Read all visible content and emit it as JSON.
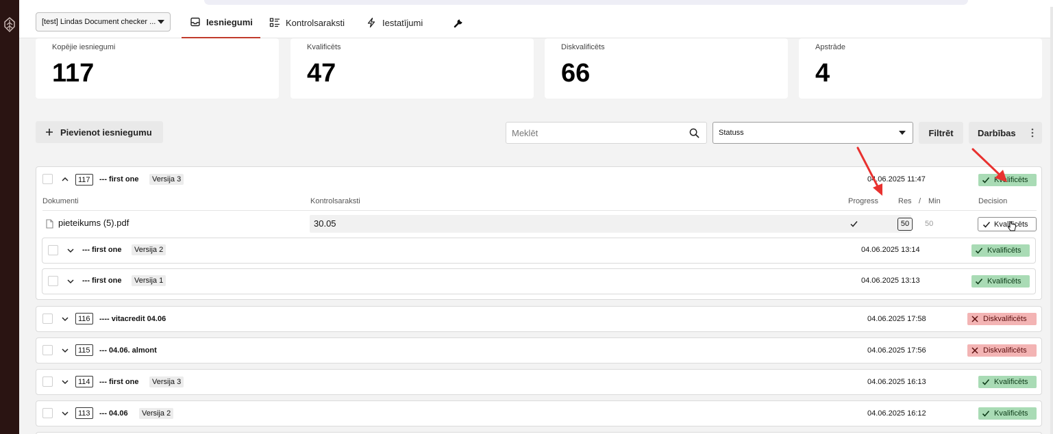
{
  "org_select": {
    "value": "[test] Lindas Document checker ..."
  },
  "nav": {
    "tabs": [
      {
        "label": "Iesniegumi"
      },
      {
        "label": "Kontrolsaraksti"
      },
      {
        "label": "Iestatījumi"
      }
    ]
  },
  "stats": [
    {
      "label": "Kopējie iesniegumi",
      "value": "117"
    },
    {
      "label": "Kvalificēts",
      "value": "47"
    },
    {
      "label": "Diskvalificēts",
      "value": "66"
    },
    {
      "label": "Apstrāde",
      "value": "4"
    }
  ],
  "toolbar": {
    "add_label": "Pievienot iesniegumu",
    "search_placeholder": "Meklēt",
    "status_value": "Statuss",
    "filter_label": "Filtrēt",
    "actions_label": "Darbības"
  },
  "expanded": {
    "id": "117",
    "title": "--- first one",
    "version": "Versija 3",
    "date": "04.06.2025 11:47",
    "status": "Kvalificēts",
    "columns": {
      "documents": "Dokumenti",
      "checklists": "Kontrolsaraksti",
      "progress": "Progress",
      "res": "Res",
      "slash": "/",
      "min": "Min",
      "decision": "Decision"
    },
    "document": {
      "name": "pieteikums (5).pdf",
      "checklist_value": "30.05",
      "res": "50",
      "min": "50",
      "decision": "Kvalificēts"
    },
    "versions": [
      {
        "title": "--- first one",
        "version": "Versija 2",
        "date": "04.06.2025 13:14",
        "status": "Kvalificēts"
      },
      {
        "title": "--- first one",
        "version": "Versija 1",
        "date": "04.06.2025 13:13",
        "status": "Kvalificēts"
      }
    ]
  },
  "rows": [
    {
      "id": "116",
      "title": "---- vitacredit 04.06",
      "version": "",
      "date": "04.06.2025 17:58",
      "status": "Diskvalificēts"
    },
    {
      "id": "115",
      "title": "--- 04.06. almont",
      "version": "",
      "date": "04.06.2025 17:56",
      "status": "Diskvalificēts"
    },
    {
      "id": "114",
      "title": "--- first one",
      "version": "Versija 3",
      "date": "04.06.2025 16:13",
      "status": "Kvalificēts"
    },
    {
      "id": "113",
      "title": "--- 04.06",
      "version": "Versija 2",
      "date": "04.06.2025 16:12",
      "status": "Kvalificēts"
    }
  ],
  "colors": {
    "accent": "#c0392b",
    "qualified": "#a9dbb5",
    "disqualified": "#f3b4b4",
    "sidebar": "#2a1412"
  },
  "icons": [
    "leaf-logo-icon",
    "inbox-icon",
    "checklist-icon",
    "bolt-icon",
    "wrench-icon",
    "plus-icon",
    "search-icon",
    "check-icon",
    "close-icon",
    "file-icon",
    "chevron-up-icon",
    "chevron-down-icon",
    "more-vertical-icon",
    "red-arrow-annotation"
  ]
}
